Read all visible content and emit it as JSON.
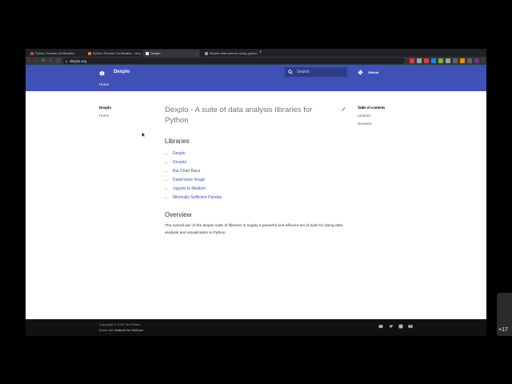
{
  "browser": {
    "tabs": [
      {
        "title": "Python Pandas Certification",
        "favicon_color": "#e53935",
        "active": false
      },
      {
        "title": "Python Pandas Certification - Acq",
        "favicon_color": "#f57c00",
        "active": false
      },
      {
        "title": "Dexplo",
        "favicon_color": "#ffffff",
        "active": true
      },
      {
        "title": "Master data science using python",
        "favicon_color": "#9e9e9e",
        "active": false
      }
    ],
    "new_tab_label": "+",
    "close_label": "×",
    "url": "dexplo.org"
  },
  "site": {
    "title": "Dexplo",
    "search_placeholder": "Search",
    "github_label": "GitHub",
    "tab_home": "Home",
    "brand_color": "#3f51b5"
  },
  "nav": {
    "title": "Dexplo",
    "items": [
      "Home"
    ]
  },
  "content": {
    "title": "Dexplo - A suite of data analysis libraries for Python",
    "libraries_heading": "Libraries",
    "libraries": [
      "Dexplo",
      "Dexplot",
      "Bar Chart Race",
      "DataFrame Image",
      "Jupyter to Medium",
      "Minimally Sufficient Pandas"
    ],
    "overview_heading": "Overview",
    "overview_text": "The overall aim of the dexplo suite of libraries is supply a powerful and efficient set of tools for doing data analysis and visualization in Python."
  },
  "toc": {
    "title": "Table of contents",
    "items": [
      "Libraries",
      "Overview"
    ]
  },
  "footer": {
    "copyright": "Copyright © 2020 Ted Petrou",
    "made_with_prefix": "Made with",
    "made_with_link": "Material for MkDocs"
  },
  "overlay": {
    "badge": "+17"
  }
}
